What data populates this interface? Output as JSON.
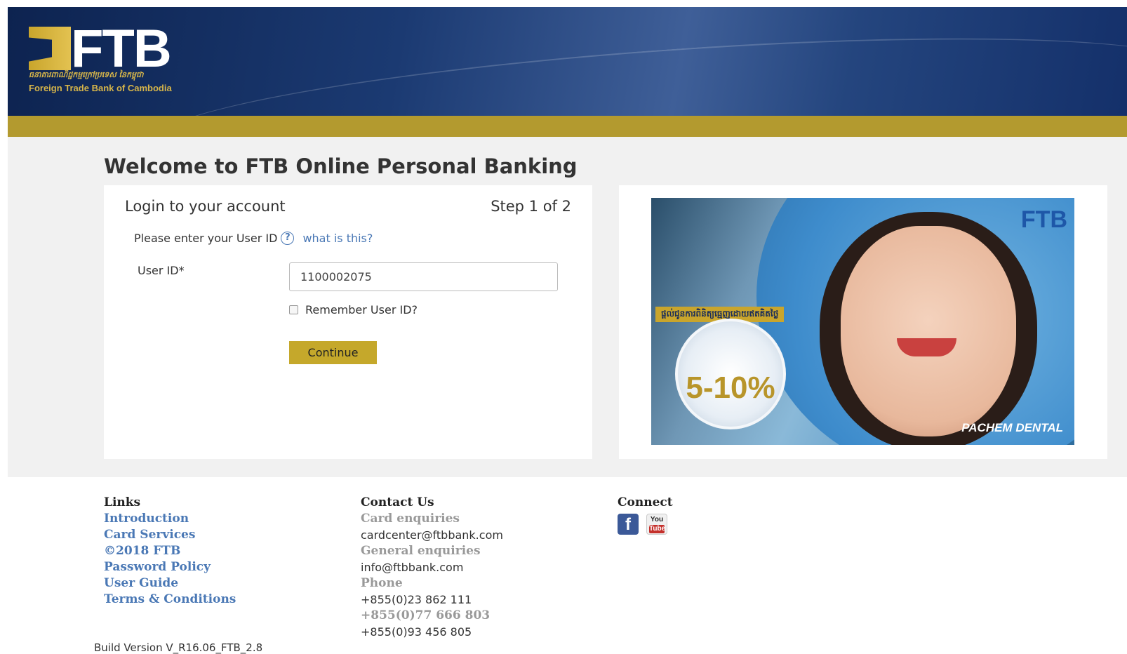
{
  "header": {
    "logo_text": "FTB",
    "logo_khmer": "ធនាគារពាណិជ្ជកម្មក្រៅប្រទេស នៃកម្ពុជា",
    "logo_subtitle": "Foreign Trade Bank of Cambodia"
  },
  "page": {
    "title": "Welcome to FTB Online Personal Banking"
  },
  "login": {
    "heading": "Login to your account",
    "step": "Step 1 of 2",
    "instruction": "Please enter your User ID",
    "help_glyph": "?",
    "what_is_this": "what is this?",
    "userid_label": "User ID*",
    "userid_value": "1100002075",
    "remember_label": "Remember User ID?",
    "remember_checked": false,
    "continue_label": "Continue"
  },
  "promo": {
    "logo": "FTB",
    "banner_text": "ផ្ដល់ជូនការពិនិត្យធ្មេញដោយឥតគិតថ្លៃ",
    "badge_text": "5-10%",
    "clinic_name": "PACHEM DENTAL"
  },
  "footer": {
    "links_heading": "Links",
    "links": [
      "Introduction",
      "Card Services",
      "©2018 FTB",
      "Password Policy",
      "User Guide",
      "Terms & Conditions"
    ],
    "contact_heading": "Contact Us",
    "card_enquiries_label": "Card enquiries",
    "card_email": "cardcenter@ftbbank.com",
    "general_enquiries_label": "General enquiries",
    "general_email": "info@ftbbank.com",
    "phone_label": "Phone",
    "phone_1": "+855(0)23 862 111",
    "phone_2": "+855(0)77 666 803",
    "phone_3": "+855(0)93 456 805",
    "connect_heading": "Connect",
    "facebook_glyph": "f",
    "youtube_glyph_top": "You",
    "youtube_glyph_bottom": "Tube"
  },
  "build_version": "Build Version V_R16.06_FTB_2.8",
  "colors": {
    "header_navy": "#1b3a72",
    "gold": "#b39a2f",
    "button_gold": "#c5a82b",
    "link_blue": "#4a78b5",
    "content_bg": "#f1f1f1"
  }
}
